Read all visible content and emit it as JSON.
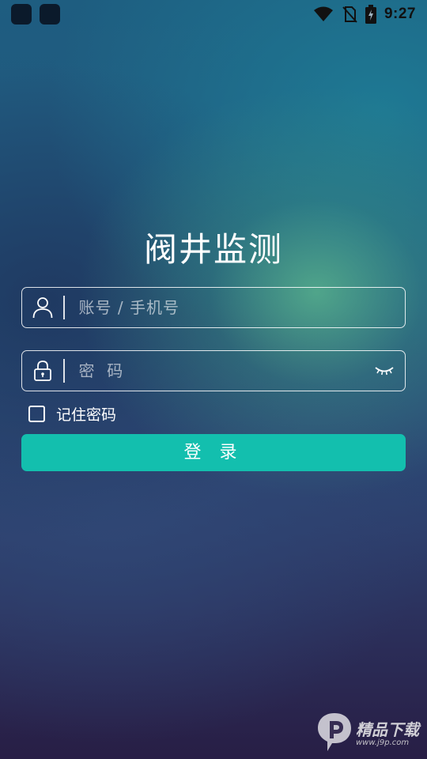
{
  "status_bar": {
    "time": "9:27",
    "icons": [
      "notification-square-icon",
      "notification-square-icon",
      "wifi-icon",
      "no-sim-icon",
      "battery-charging-icon"
    ]
  },
  "app": {
    "title": "阀井监测"
  },
  "login_form": {
    "account": {
      "placeholder": "账号 / 手机号",
      "value": "",
      "icon": "user-icon"
    },
    "password": {
      "placeholder": "密  码",
      "value": "",
      "icon": "lock-icon",
      "toggle_icon": "eye-closed-icon"
    },
    "remember": {
      "label": "记住密码",
      "checked": false
    },
    "submit_label": "登 录"
  },
  "watermark": {
    "main": "精品下载",
    "sub": "www.j9p.com"
  },
  "colors": {
    "accent": "#13bfae",
    "text": "#ffffff"
  }
}
